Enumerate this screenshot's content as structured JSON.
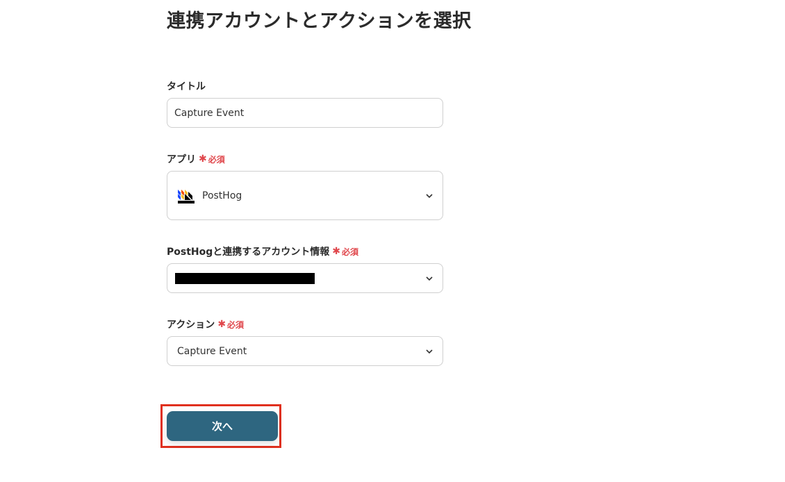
{
  "page": {
    "title": "連携アカウントとアクションを選択"
  },
  "required_text": "必須",
  "fields": {
    "title": {
      "label": "タイトル",
      "value": "Capture Event"
    },
    "app": {
      "label": "アプリ",
      "value": "PostHog",
      "icon": "posthog-logo"
    },
    "account": {
      "label": "PostHogと連携するアカウント情報",
      "value": ""
    },
    "action": {
      "label": "アクション",
      "value": "Capture Event"
    }
  },
  "next_button": {
    "label": "次へ"
  },
  "colors": {
    "required": "#e0474c",
    "primary_button": "#2e6680",
    "highlight_border": "#e0301e"
  }
}
